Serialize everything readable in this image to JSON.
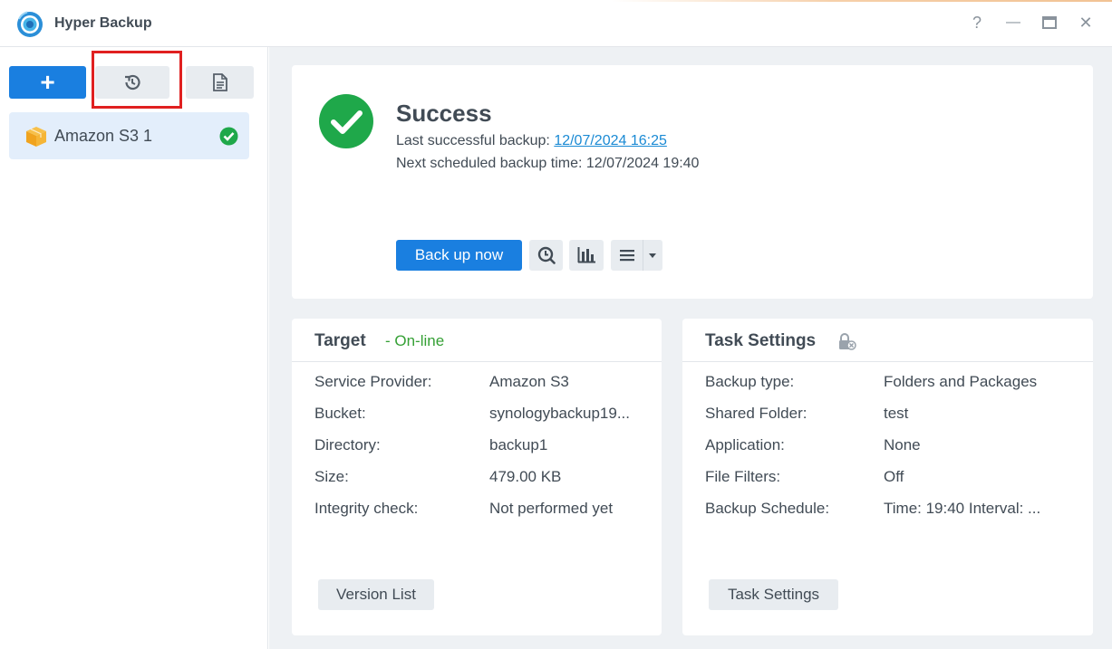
{
  "window": {
    "title": "Hyper Backup",
    "help_glyph": "?",
    "minimize_glyph": "—",
    "close_glyph": "✕"
  },
  "sidebar": {
    "toolbar": {
      "add_glyph": "+"
    },
    "tasks": [
      {
        "label": "Amazon S3 1",
        "status": "success"
      }
    ]
  },
  "status": {
    "title": "Success",
    "last_backup_label": "Last successful backup: ",
    "last_backup_value": "12/07/2024 16:25",
    "next_backup_label": "Next scheduled backup time: ",
    "next_backup_value": "12/07/2024 19:40",
    "backup_now_label": "Back up now"
  },
  "target": {
    "title": "Target",
    "status": "- On-line",
    "rows": [
      {
        "key": "Service Provider:",
        "value": "Amazon S3"
      },
      {
        "key": "Bucket:",
        "value": "synologybackup19..."
      },
      {
        "key": "Directory:",
        "value": "backup1"
      },
      {
        "key": "Size:",
        "value": "479.00 KB"
      },
      {
        "key": "Integrity check:",
        "value": "Not performed yet"
      }
    ],
    "button_label": "Version List"
  },
  "task_settings": {
    "title": "Task Settings",
    "rows": [
      {
        "key": "Backup type:",
        "value": "Folders and Packages"
      },
      {
        "key": "Shared Folder:",
        "value": "test"
      },
      {
        "key": "Application:",
        "value": "None"
      },
      {
        "key": "File Filters:",
        "value": "Off"
      },
      {
        "key": "Backup Schedule:",
        "value": "Time: 19:40 Interval: ..."
      }
    ],
    "button_label": "Task Settings"
  },
  "colors": {
    "accent": "#1a7fe0",
    "success": "#1fa84a",
    "online": "#35a035",
    "highlight": "#e02020"
  }
}
